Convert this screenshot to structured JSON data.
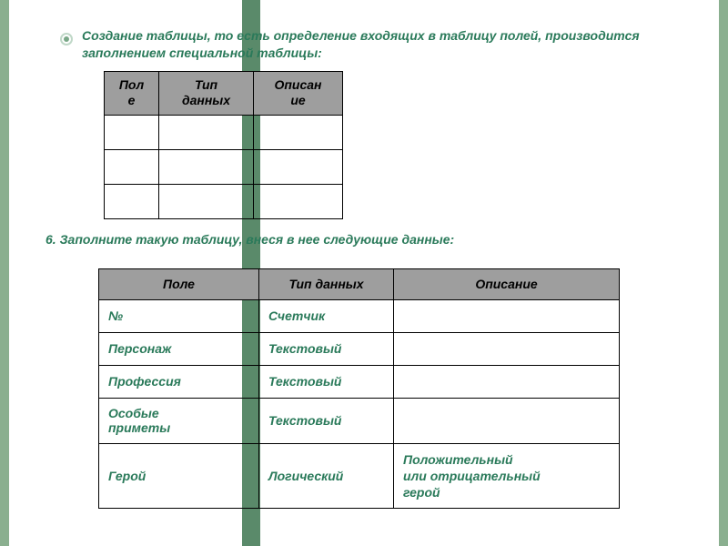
{
  "intro": "Создание таблицы, то есть определение входящих в таблицу полей, производится заполнением специальной таблицы:",
  "table1": {
    "headers": [
      "Пол\nе",
      "Тип\nданных",
      "Описан\nие"
    ]
  },
  "instruction": "6. Заполните такую таблицу, внеся в нее следующие данные:",
  "table2": {
    "headers": [
      "Поле",
      "Тип данных",
      "Описание"
    ],
    "rows": [
      {
        "field": "№",
        "type": "Счетчик",
        "desc": ""
      },
      {
        "field": "Персонаж",
        "type": "Текстовый",
        "desc": ""
      },
      {
        "field": "Профессия",
        "type": "Текстовый",
        "desc": ""
      },
      {
        "field": "Особые\nприметы",
        "type": "Текстовый",
        "desc": ""
      },
      {
        "field": "Герой",
        "type": "Логический",
        "desc": "Положительный\nили отрицательный\nгерой"
      }
    ]
  }
}
